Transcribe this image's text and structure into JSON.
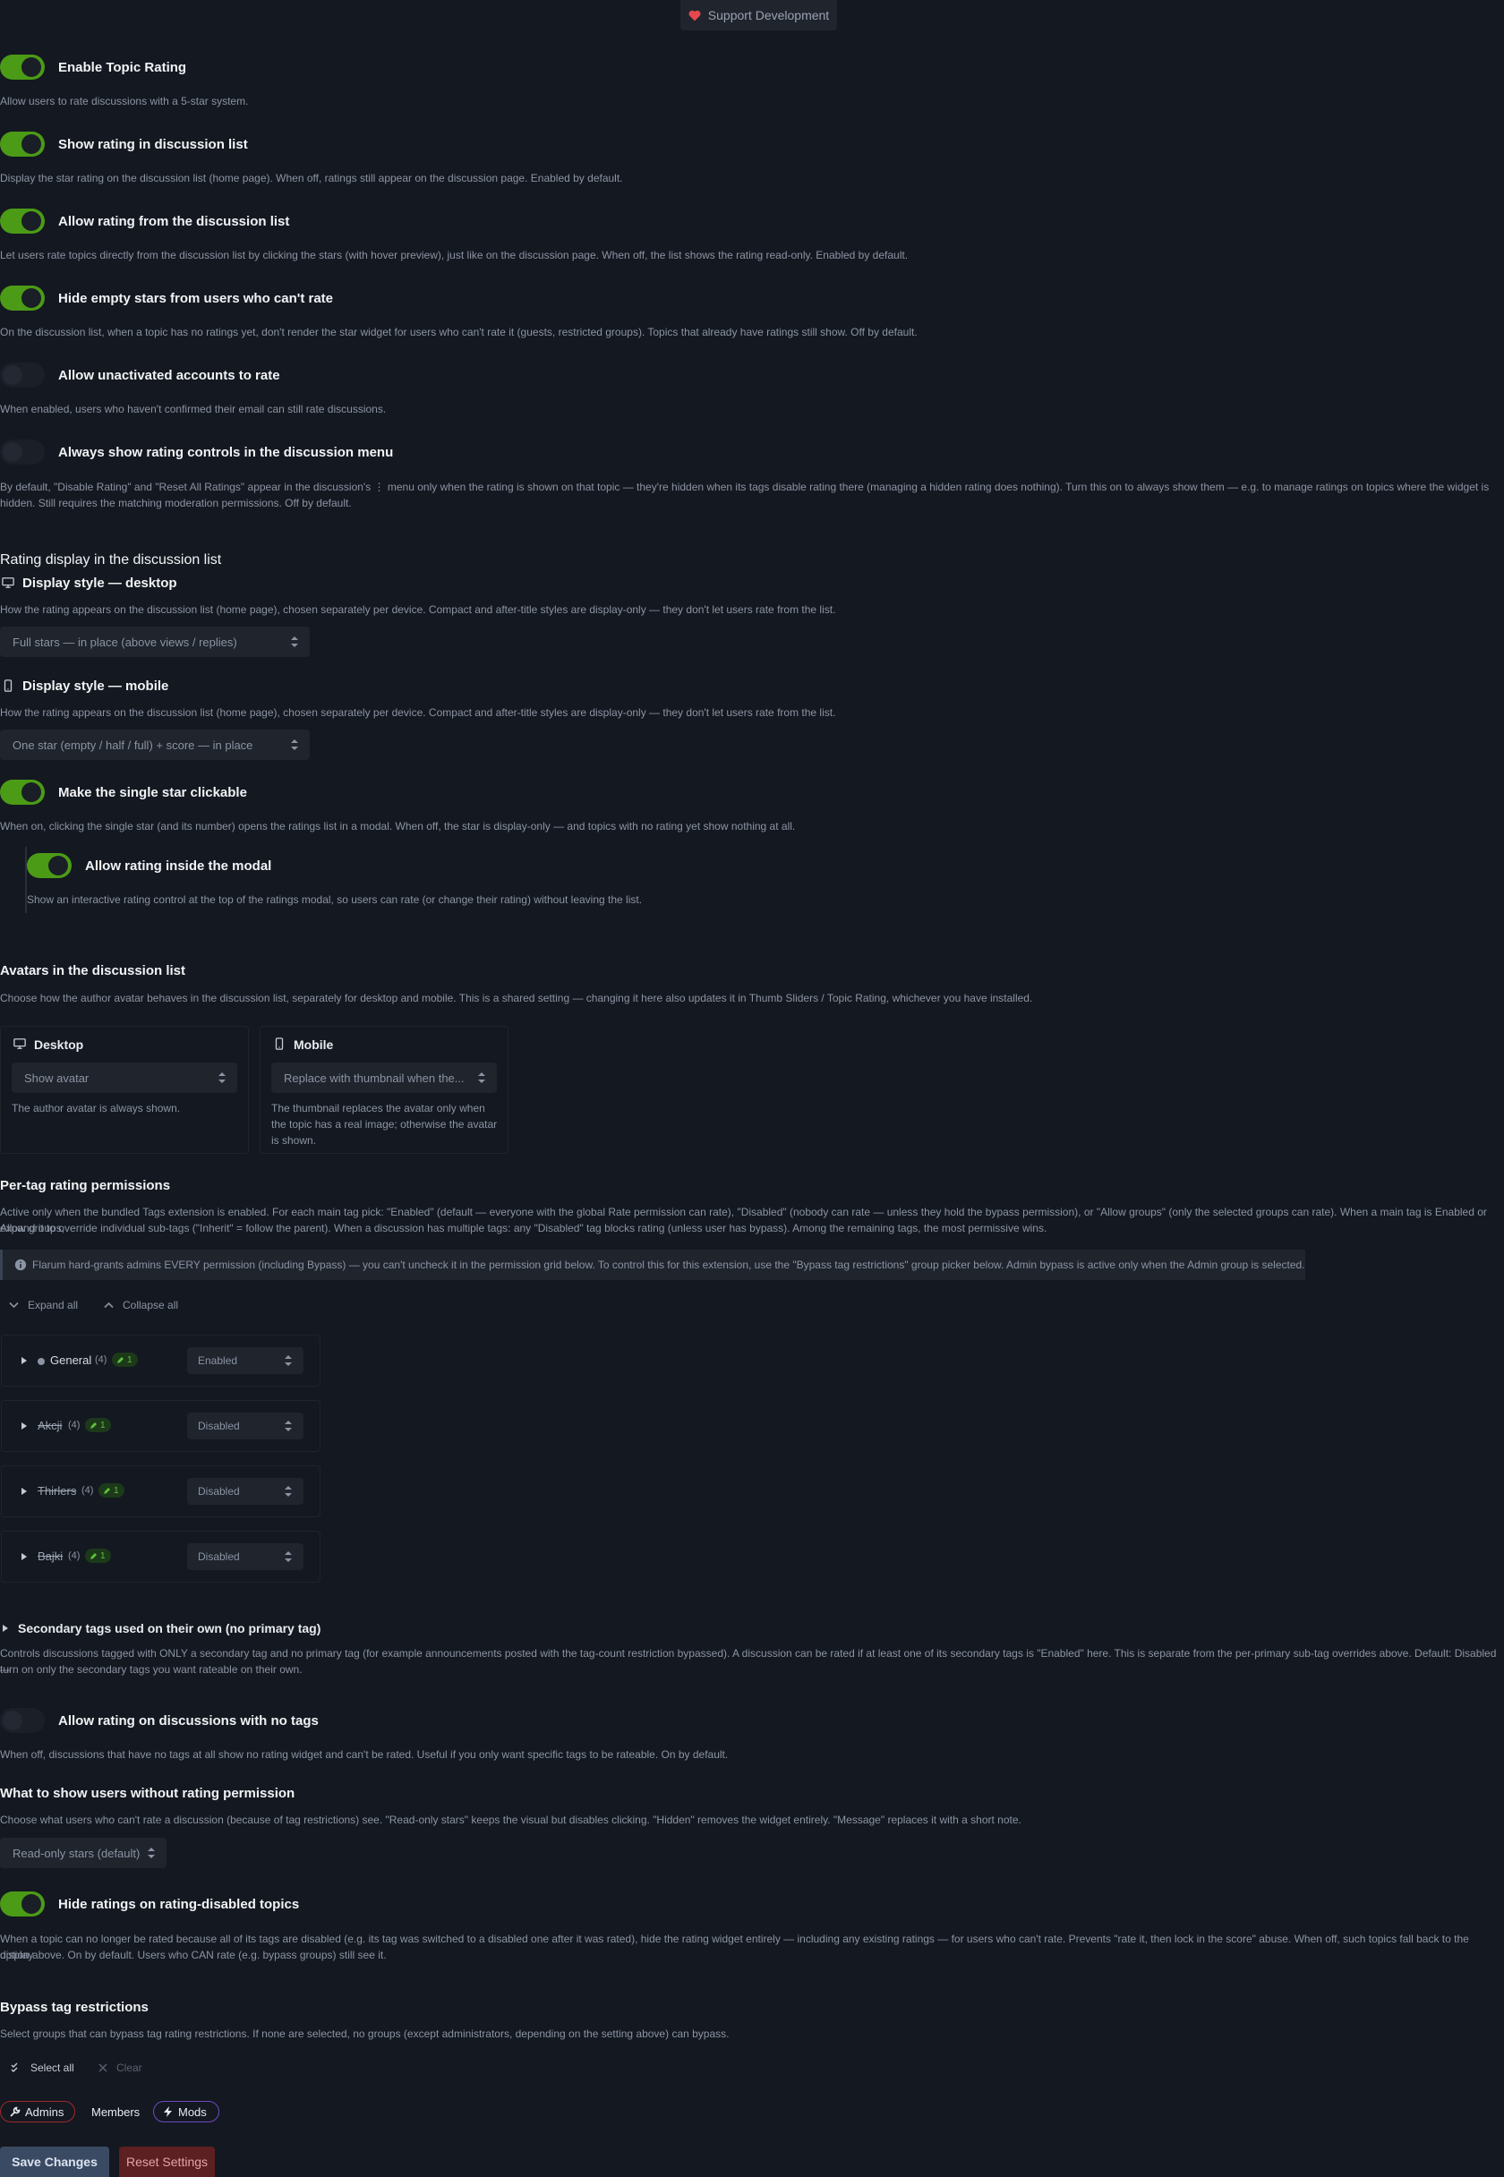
{
  "support": {
    "label": "Support Development",
    "icon": "heart-icon"
  },
  "colors": {
    "toggle_on": "#4b9b16",
    "background": "#141820",
    "accent_admin": "#e5484d",
    "accent_mods": "#8b5cf6",
    "save": "#3b4a63",
    "reset": "#5c1f22"
  },
  "settings": {
    "enable_rating": {
      "label": "Enable Topic Rating",
      "help": "Allow users to rate discussions with a 5-star system.",
      "on": true
    },
    "show_in_list": {
      "label": "Show rating in discussion list",
      "help": "Display the star rating on the discussion list (home page). When off, ratings still appear on the discussion page. Enabled by default.",
      "on": true
    },
    "rate_from_list": {
      "label": "Allow rating from the discussion list",
      "help": "Let users rate topics directly from the discussion list by clicking the stars (with hover preview), just like on the discussion page. When off, the list shows the rating read-only. Enabled by default.",
      "on": true
    },
    "hide_empty": {
      "label": "Hide empty stars from users who can't rate",
      "help": "On the discussion list, when a topic has no ratings yet, don't render the star widget for users who can't rate it (guests, restricted groups). Topics that already have ratings still show. Off by default.",
      "on": true
    },
    "unactivated": {
      "label": "Allow unactivated accounts to rate",
      "help": "When enabled, users who haven't confirmed their email can still rate discussions.",
      "on": false
    },
    "always_menu": {
      "label": "Always show rating controls in the discussion menu",
      "help1": "By default, \"Disable Rating\" and \"Reset All Ratings\" appear in the discussion's ⋮ menu only when the rating is shown on that topic — they're hidden when its tags disable rating there (managing a hidden rating does nothing). Turn this on to always show them — e.g. to manage ratings on topics where the widget is",
      "help2": "hidden. Still requires the matching moderation permissions. Off by default.",
      "on": false
    }
  },
  "list_display": {
    "heading": "Rating display in the discussion list",
    "desktop": {
      "label": "Display style — desktop",
      "icon": "monitor-icon",
      "help": "How the rating appears on the discussion list (home page), chosen separately per device. Compact and after-title styles are display-only — they don't let users rate from the list.",
      "value": "Full stars — in place (above views / replies)"
    },
    "mobile": {
      "label": "Display style — mobile",
      "icon": "phone-icon",
      "help": "How the rating appears on the discussion list (home page), chosen separately per device. Compact and after-title styles are display-only — they don't let users rate from the list.",
      "value": "One star (empty / half / full) + score — in place"
    },
    "single_star": {
      "label": "Make the single star clickable",
      "help": "When on, clicking the single star (and its number) opens the ratings list in a modal. When off, the star is display-only — and topics with no rating yet show nothing at all.",
      "on": true
    },
    "modal_rating": {
      "label": "Allow rating inside the modal",
      "help": "Show an interactive rating control at the top of the ratings modal, so users can rate (or change their rating) without leaving the list.",
      "on": true
    }
  },
  "avatars": {
    "heading": "Avatars in the discussion list",
    "help": "Choose how the author avatar behaves in the discussion list, separately for desktop and mobile. This is a shared setting — changing it here also updates it in Thumb Sliders / Topic Rating, whichever you have installed.",
    "desktop": {
      "label": "Desktop",
      "value": "Show avatar",
      "note": "The author avatar is always shown."
    },
    "mobile": {
      "label": "Mobile",
      "value": "Replace with thumbnail when the...",
      "note1": "The thumbnail replaces the avatar only when",
      "note2": "the topic has a real image; otherwise the avatar",
      "note3": "is shown."
    }
  },
  "per_tag": {
    "heading": "Per-tag rating permissions",
    "help1": "Active only when the bundled Tags extension is enabled. For each main tag pick: \"Enabled\" (default — everyone with the global Rate permission can rate), \"Disabled\" (nobody can rate — unless they hold the bypass permission), or \"Allow groups\" (only the selected groups can rate). When a main tag is Enabled or Allow groups,",
    "help2": "expand it to override individual sub-tags (\"Inherit\" = follow the parent). When a discussion has multiple tags: any \"Disabled\" tag blocks rating (unless user has bypass). Among the remaining tags, the most permissive wins.",
    "notice": "Flarum hard-grants admins EVERY permission (including Bypass) — you can't uncheck it in the permission grid below. To control this for this extension, use the \"Bypass tag restrictions\" group picker below. Admin bypass is active only when the Admin group is selected.",
    "expand_all": "Expand all",
    "collapse_all": "Collapse all",
    "tags": [
      {
        "name": "General",
        "count": "(4)",
        "badge": "1",
        "value": "Enabled",
        "strike": false
      },
      {
        "name": "Akcji",
        "count": "(4)",
        "badge": "1",
        "value": "Disabled",
        "strike": true
      },
      {
        "name": "Thirlers",
        "count": "(4)",
        "badge": "1",
        "value": "Disabled",
        "strike": true
      },
      {
        "name": "Bajki",
        "count": "(4)",
        "badge": "1",
        "value": "Disabled",
        "strike": true
      }
    ],
    "secondary": {
      "label": "Secondary tags used on their own (no primary tag)",
      "help1": "Controls discussions tagged with ONLY a secondary tag and no primary tag (for example announcements posted with the tag-count restriction bypassed). A discussion can be rated if at least one of its secondary tags is \"Enabled\" here. This is separate from the per-primary sub-tag overrides above. Default: Disabled —",
      "help2": "turn on only the secondary tags you want rateable on their own."
    }
  },
  "no_tags": {
    "label": "Allow rating on discussions with no tags",
    "help": "When off, discussions that have no tags at all show no rating widget and can't be rated. Useful if you only want specific tags to be rateable. On by default.",
    "on": false
  },
  "no_permission": {
    "heading": "What to show users without rating permission",
    "help": "Choose what users who can't rate a discussion (because of tag restrictions) see. \"Read-only stars\" keeps the visual but disables clicking. \"Hidden\" removes the widget entirely. \"Message\" replaces it with a short note.",
    "value": "Read-only stars (default)"
  },
  "hide_disabled": {
    "label": "Hide ratings on rating-disabled topics",
    "help1": "When a topic can no longer be rated because all of its tags are disabled (e.g. its tag was switched to a disabled one after it was rated), hide the rating widget entirely — including any existing ratings — for users who can't rate. Prevents \"rate it, then lock in the score\" abuse. When off, such topics fall back to the display",
    "help2": "option above. On by default. Users who CAN rate (e.g. bypass groups) still see it.",
    "on": true
  },
  "bypass": {
    "heading": "Bypass tag restrictions",
    "help": "Select groups that can bypass tag rating restrictions. If none are selected, no groups (except administrators, depending on the setting above) can bypass.",
    "select_all": "Select all",
    "clear": "Clear",
    "groups": [
      "Admins",
      "Members",
      "Mods"
    ]
  },
  "actions": {
    "save": "Save Changes",
    "reset": "Reset Settings"
  }
}
